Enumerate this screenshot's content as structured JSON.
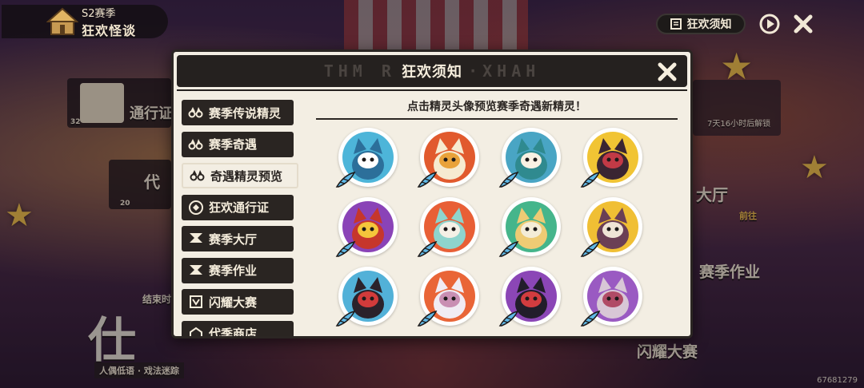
{
  "background": {
    "season_badge": {
      "line1": "S2赛季",
      "line2": "狂欢怪谈"
    },
    "notice_button_label": "狂欢须知",
    "left_labels": {
      "pass": "通行证",
      "pass_level": "32",
      "proxy": "代",
      "proxy_count": "20",
      "ended_hint": "结束时",
      "logo_sub": "人偶低语 · 戏法迷踪"
    },
    "right_labels": {
      "unlock_hint": "7天16小时后解锁",
      "hall": "大厅",
      "go": "前往",
      "homework": "赛季作业",
      "contest": "闪耀大赛"
    },
    "uid": "67681279"
  },
  "modal": {
    "title": "狂欢须知",
    "ghost_text": "THM R ··· ·XHAH",
    "content_title": "点击精灵头像预览赛季奇遇新精灵！",
    "tabs": [
      {
        "label": "赛季传说精灵",
        "icon": "binoculars-icon",
        "active": false
      },
      {
        "label": "赛季奇遇",
        "icon": "binoculars-icon",
        "active": false
      },
      {
        "label": "奇遇精灵预览",
        "icon": "binoculars-icon",
        "active": true
      },
      {
        "label": "狂欢通行证",
        "icon": "ticket-icon",
        "active": false
      },
      {
        "label": "赛季大厅",
        "icon": "pennant-icon",
        "active": false
      },
      {
        "label": "赛季作业",
        "icon": "pennant-icon",
        "active": false
      },
      {
        "label": "闪耀大赛",
        "icon": "trophy-icon",
        "active": false
      },
      {
        "label": "代季商店",
        "icon": "shop-icon",
        "active": false
      }
    ],
    "spirits": [
      {
        "name": "blue-ghost-spirit",
        "bg": "#4db5d9",
        "body": "#2c6f9a",
        "face": "#ffffff"
      },
      {
        "name": "bell-spirit",
        "bg": "#e15a2e",
        "body": "#f6ead0",
        "face": "#e9a23a"
      },
      {
        "name": "hooded-spirit",
        "bg": "#49a5c4",
        "body": "#2f8a8f",
        "face": "#f8f1e3"
      },
      {
        "name": "rat-spirit",
        "bg": "#f1c434",
        "body": "#3a2532",
        "face": "#c23a46"
      },
      {
        "name": "bottle-spirit",
        "bg": "#8a43b7",
        "body": "#c6362c",
        "face": "#f4c53b"
      },
      {
        "name": "jester-spirit",
        "bg": "#e85f36",
        "body": "#8ed4cd",
        "face": "#f5f0e6"
      },
      {
        "name": "lamp-spirit",
        "bg": "#45b58b",
        "body": "#eecb74",
        "face": "#f3ecd7"
      },
      {
        "name": "hat-spirit",
        "bg": "#f0bf34",
        "body": "#6b3f55",
        "face": "#efe4d6"
      },
      {
        "name": "beetle-spirit",
        "bg": "#52b1d8",
        "body": "#2b222b",
        "face": "#d23b3b"
      },
      {
        "name": "mask-spirit",
        "bg": "#e96537",
        "body": "#f1ecf3",
        "face": "#c98fb3"
      },
      {
        "name": "horse-spirit",
        "bg": "#8b46b6",
        "body": "#221d2a",
        "face": "#d23c3f"
      },
      {
        "name": "teapot-spirit",
        "bg": "#9a5ac2",
        "body": "#d8c7d6",
        "face": "#b04b66"
      }
    ]
  }
}
